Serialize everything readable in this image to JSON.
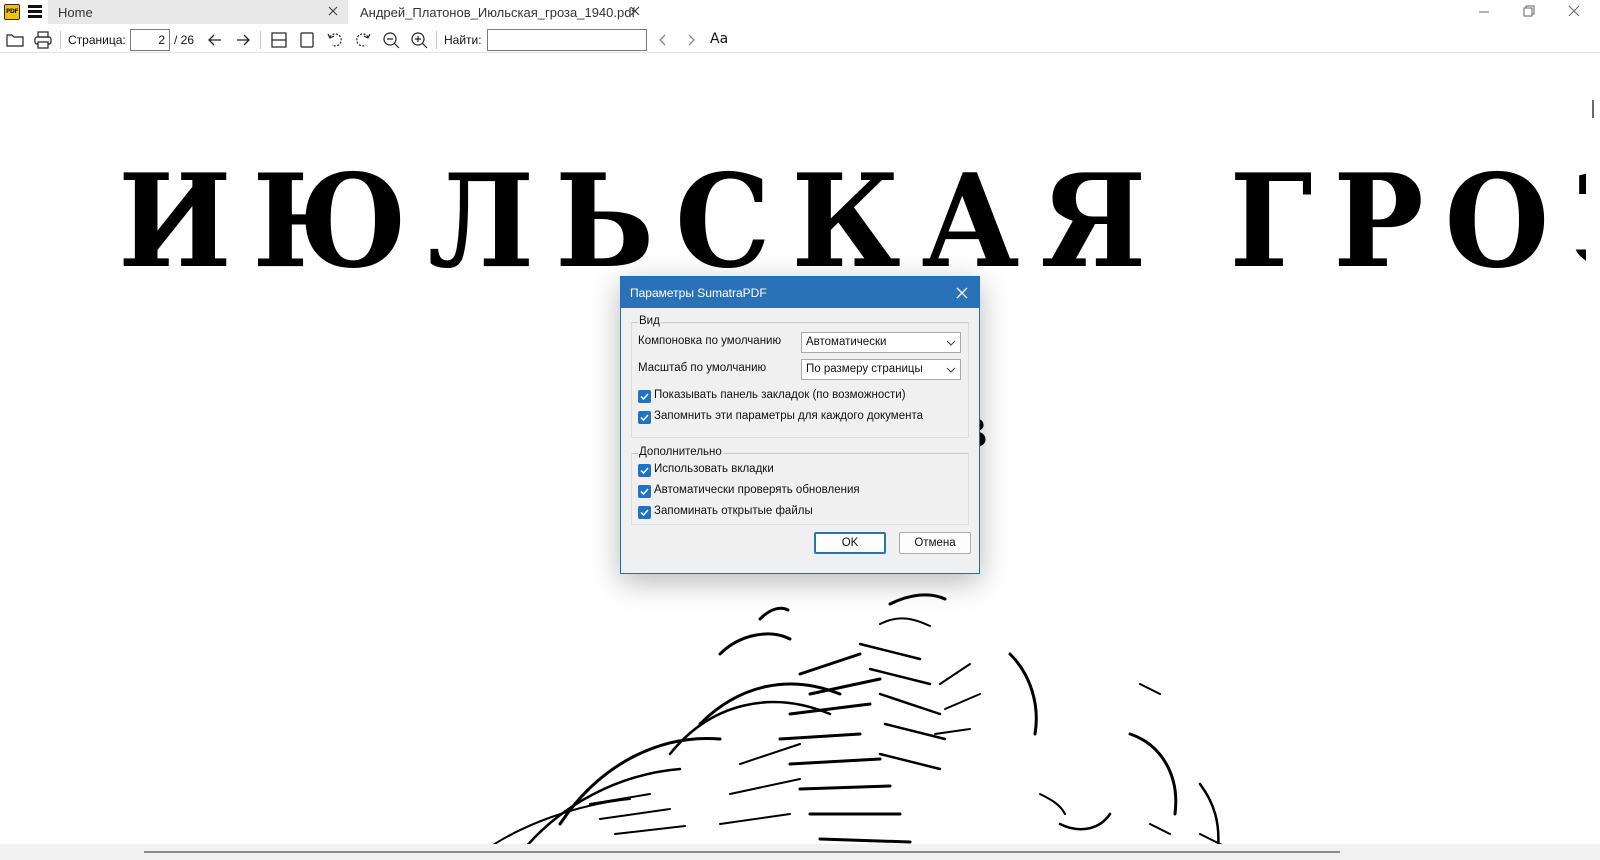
{
  "window": {
    "app_logo_text": "PDF",
    "tabs": [
      {
        "label": "Home",
        "active": true
      },
      {
        "label": "Андрей_Платонов_Июльская_гроза_1940.pdf",
        "active": false
      }
    ],
    "controls": [
      "minimize-icon",
      "restore-icon",
      "close-icon"
    ]
  },
  "toolbar": {
    "page_label": "Страница:",
    "current_page": "2",
    "total_pages": "/ 26",
    "find_label": "Найти:",
    "find_value": "",
    "case_label": "Aa",
    "icons": [
      "open-folder-icon",
      "print-icon",
      "prev-page-icon",
      "next-page-icon",
      "fit-width-icon",
      "fit-page-icon",
      "rotate-left-icon",
      "rotate-right-icon",
      "zoom-out-icon",
      "zoom-in-icon",
      "find-prev-icon",
      "find-next-icon",
      "match-case-icon"
    ]
  },
  "document": {
    "title": "ИЮЛЬСКАЯ ГРОЗА",
    "partial_text": "з"
  },
  "dialog": {
    "title": "Параметры SumatraPDF",
    "view_group": {
      "legend": "Вид",
      "layout_label": "Компоновка по умолчанию",
      "layout_value": "Автоматически",
      "zoom_label": "Масштаб по умолчанию",
      "zoom_value": "По размеру страницы",
      "checkboxes": [
        {
          "label": "Показывать панель закладок (по возможности)",
          "checked": true
        },
        {
          "label": "Запомнить эти параметры для каждого документа",
          "checked": true
        }
      ]
    },
    "advanced_group": {
      "legend": "Дополнительно",
      "checkboxes": [
        {
          "label": "Использовать вкладки",
          "checked": true
        },
        {
          "label": "Автоматически проверять обновления",
          "checked": true
        },
        {
          "label": "Запоминать открытые файлы",
          "checked": true
        }
      ]
    },
    "ok_label": "OK",
    "cancel_label": "Отмена"
  },
  "colors": {
    "dialog_accent": "#2a72b8",
    "checkbox": "#1f73c4",
    "app_logo": "#f3c300"
  }
}
